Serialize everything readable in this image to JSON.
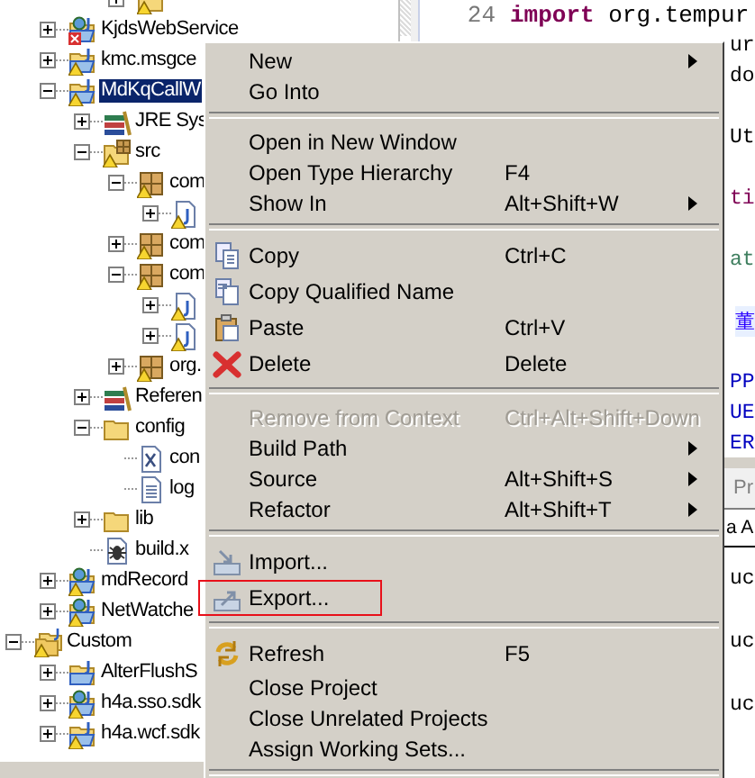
{
  "tree": [
    {
      "kind": "folder",
      "warning": true,
      "error": false,
      "expanded": false,
      "selected": false
    },
    {
      "label": "KjdsWebService",
      "kind": "web-project",
      "warning": false,
      "error": true,
      "expanded": false,
      "selected": false
    },
    {
      "label": "kmc.msgce",
      "kind": "project",
      "warning": true,
      "error": false,
      "expanded": false,
      "selected": false
    },
    {
      "label": "MdKqCallW",
      "kind": "project",
      "warning": true,
      "error": false,
      "expanded": true,
      "selected": true,
      "children": [
        {
          "label": "JRE Sys",
          "kind": "library",
          "warning": false,
          "error": false,
          "expanded": false,
          "selected": false
        },
        {
          "label": "src",
          "kind": "source-folder",
          "warning": true,
          "error": false,
          "expanded": true,
          "selected": false,
          "children": [
            {
              "label": "com",
              "kind": "package",
              "warning": true,
              "error": false,
              "expanded": true,
              "selected": false,
              "children": [
                {
                  "kind": "java-file",
                  "warning": true,
                  "error": false,
                  "expanded": false,
                  "selected": false
                }
              ]
            },
            {
              "label": "com",
              "kind": "package",
              "warning": true,
              "error": false,
              "expanded": false,
              "selected": false
            },
            {
              "label": "com",
              "kind": "package",
              "warning": true,
              "error": false,
              "expanded": true,
              "selected": false,
              "children": [
                {
                  "kind": "java-file",
                  "warning": true,
                  "error": false,
                  "expanded": false,
                  "selected": false
                },
                {
                  "kind": "java-file",
                  "warning": true,
                  "error": false,
                  "expanded": false,
                  "selected": false
                }
              ]
            },
            {
              "label": "org.",
              "kind": "package",
              "warning": true,
              "error": false,
              "expanded": false,
              "selected": false
            }
          ]
        },
        {
          "label": "Referen",
          "kind": "library",
          "warning": false,
          "error": false,
          "expanded": false,
          "selected": false
        },
        {
          "label": "config",
          "kind": "folder",
          "warning": false,
          "error": false,
          "expanded": true,
          "selected": false,
          "children": [
            {
              "label": "con",
              "kind": "xml-file",
              "warning": false,
              "error": false,
              "selected": false
            },
            {
              "label": "log",
              "kind": "text-file",
              "warning": false,
              "error": false,
              "selected": false
            }
          ]
        },
        {
          "label": "lib",
          "kind": "folder",
          "warning": false,
          "error": false,
          "expanded": false,
          "selected": false
        },
        {
          "label": "build.x",
          "kind": "ant-file",
          "warning": false,
          "error": false,
          "selected": false
        }
      ]
    },
    {
      "label": "mdRecord",
      "kind": "web-project",
      "warning": true,
      "error": false,
      "expanded": false,
      "selected": false
    },
    {
      "label": "NetWatche",
      "kind": "web-project",
      "warning": true,
      "error": false,
      "expanded": false,
      "selected": false
    },
    {
      "label": "Custom",
      "kind": "working-set",
      "warning": true,
      "error": false,
      "expanded": true,
      "selected": false,
      "children": [
        {
          "label": "AlterFlushS",
          "kind": "project",
          "warning": false,
          "error": false,
          "expanded": false,
          "selected": false
        },
        {
          "label": "h4a.sso.sdk",
          "kind": "web-project",
          "warning": true,
          "error": false,
          "expanded": false,
          "selected": false
        },
        {
          "label": "h4a.wcf.sdk",
          "kind": "project",
          "warning": true,
          "error": false,
          "expanded": false,
          "selected": false
        }
      ]
    }
  ],
  "editor": {
    "lines": [
      {
        "number": "24",
        "keyword": "import",
        "text": " org.tempur",
        "kind": "full"
      },
      {
        "text": "ur",
        "kind": "plain"
      },
      {
        "text": "do",
        "kind": "plain"
      },
      {
        "kind": "blank"
      },
      {
        "text": "Ut",
        "kind": "plain"
      },
      {
        "kind": "blank"
      },
      {
        "text": "ti",
        "kind": "keyword"
      },
      {
        "kind": "blank"
      },
      {
        "text": "at",
        "kind": "comment"
      },
      {
        "kind": "blank"
      },
      {
        "text": "董",
        "kind": "string"
      },
      {
        "kind": "blank"
      },
      {
        "text": "PP",
        "kind": "constant"
      },
      {
        "text": "UE",
        "kind": "constant"
      },
      {
        "text": "ER",
        "kind": "constant"
      }
    ]
  },
  "bottom_panel": {
    "tab": "Pr",
    "lines": [
      {
        "text": "a A",
        "kind": "header"
      },
      {
        "text": "uc",
        "kind": "plain"
      },
      {
        "text": "uc",
        "kind": "plain"
      },
      {
        "text": "uc",
        "kind": "plain"
      }
    ]
  },
  "context_menu": {
    "items": [
      {
        "kind": "item",
        "label": "New",
        "submenu": true,
        "disabled": false,
        "highlighted": false
      },
      {
        "kind": "item",
        "label": "Go Into",
        "submenu": false,
        "disabled": false,
        "highlighted": false
      },
      {
        "kind": "separator"
      },
      {
        "kind": "item",
        "label": "Open in New Window",
        "submenu": false,
        "disabled": false,
        "highlighted": false
      },
      {
        "kind": "item",
        "label": "Open Type Hierarchy",
        "shortcut": "F4",
        "submenu": false,
        "disabled": false,
        "highlighted": false
      },
      {
        "kind": "item",
        "label": "Show In",
        "shortcut": "Alt+Shift+W",
        "submenu": true,
        "disabled": false,
        "highlighted": false
      },
      {
        "kind": "separator"
      },
      {
        "kind": "item",
        "label": "Copy",
        "shortcut": "Ctrl+C",
        "submenu": false,
        "disabled": false,
        "highlighted": false
      },
      {
        "kind": "item",
        "label": "Copy Qualified Name",
        "submenu": false,
        "disabled": false,
        "highlighted": false
      },
      {
        "kind": "item",
        "label": "Paste",
        "shortcut": "Ctrl+V",
        "submenu": false,
        "disabled": false,
        "highlighted": false
      },
      {
        "kind": "item",
        "label": "Delete",
        "shortcut": "Delete",
        "submenu": false,
        "disabled": false,
        "highlighted": false
      },
      {
        "kind": "separator"
      },
      {
        "kind": "item",
        "label": "Remove from Context",
        "shortcut": "Ctrl+Alt+Shift+Down",
        "submenu": false,
        "disabled": true,
        "highlighted": false
      },
      {
        "kind": "item",
        "label": "Build Path",
        "submenu": true,
        "disabled": false,
        "highlighted": false
      },
      {
        "kind": "item",
        "label": "Source",
        "shortcut": "Alt+Shift+S",
        "submenu": true,
        "disabled": false,
        "highlighted": false
      },
      {
        "kind": "item",
        "label": "Refactor",
        "shortcut": "Alt+Shift+T",
        "submenu": true,
        "disabled": false,
        "highlighted": false
      },
      {
        "kind": "separator"
      },
      {
        "kind": "item",
        "label": "Import...",
        "submenu": false,
        "disabled": false,
        "highlighted": false
      },
      {
        "kind": "item",
        "label": "Export...",
        "submenu": false,
        "disabled": false,
        "highlighted": true
      },
      {
        "kind": "separator"
      },
      {
        "kind": "item",
        "label": "Refresh",
        "shortcut": "F5",
        "submenu": false,
        "disabled": false,
        "highlighted": false
      },
      {
        "kind": "item",
        "label": "Close Project",
        "submenu": false,
        "disabled": false,
        "highlighted": false
      },
      {
        "kind": "item",
        "label": "Close Unrelated Projects",
        "submenu": false,
        "disabled": false,
        "highlighted": false
      },
      {
        "kind": "item",
        "label": "Assign Working Sets...",
        "submenu": false,
        "disabled": false,
        "highlighted": false
      },
      {
        "kind": "separator"
      }
    ]
  }
}
